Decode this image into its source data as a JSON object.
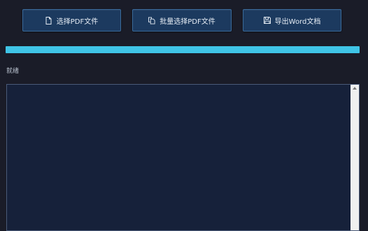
{
  "toolbar": {
    "select_pdf_label": "选择PDF文件",
    "batch_select_pdf_label": "批量选择PDF文件",
    "export_word_label": "导出Word文档"
  },
  "progress": {
    "value": 1.0,
    "fill_color": "#3fc4e6"
  },
  "status": {
    "text": "就绪"
  },
  "log": {
    "content": ""
  },
  "icons": {
    "select": "file-icon",
    "batch": "files-icon",
    "export": "save-icon"
  }
}
